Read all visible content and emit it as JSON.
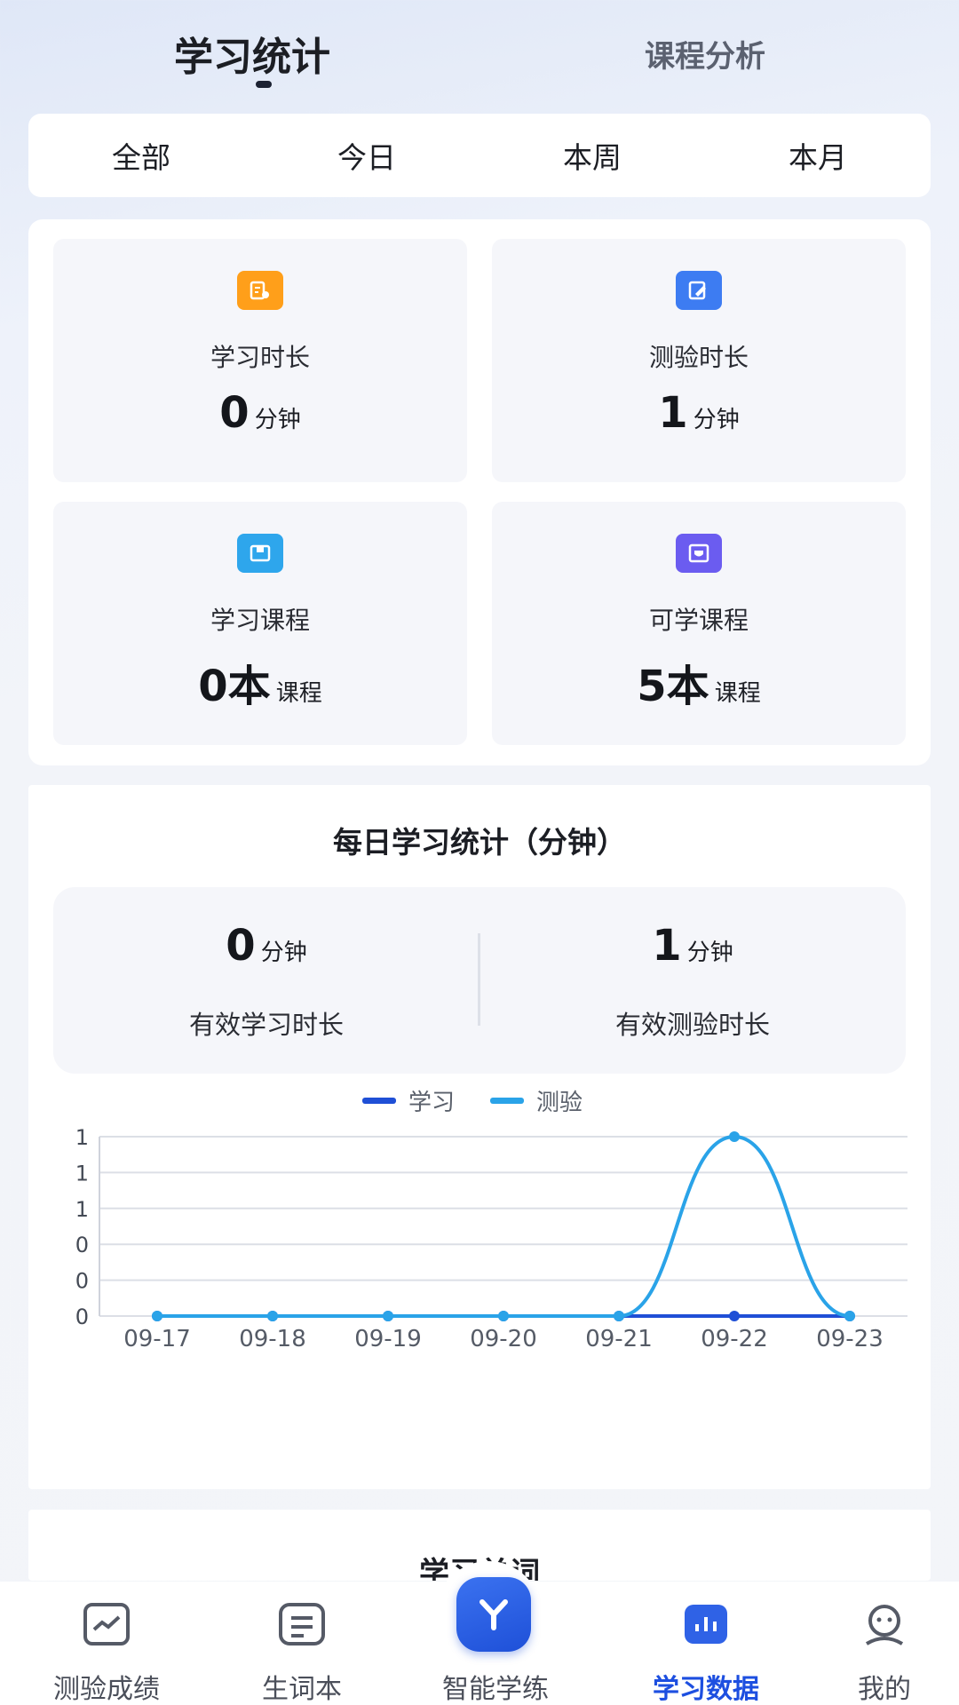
{
  "top_tabs": {
    "active": "学习统计",
    "inactive": "课程分析"
  },
  "filters": [
    "全部",
    "今日",
    "本周",
    "本月"
  ],
  "stats": [
    {
      "label": "学习时长",
      "value": "0",
      "unit": "分钟",
      "icon": "study-time-icon",
      "color": "#ff9f1a"
    },
    {
      "label": "测验时长",
      "value": "1",
      "unit": "分钟",
      "icon": "quiz-time-icon",
      "color": "#3d7cf2"
    },
    {
      "label": "学习课程",
      "value": "0本",
      "unit": "课程",
      "icon": "course-icon",
      "color": "#2ea6ec"
    },
    {
      "label": "可学课程",
      "value": "5本",
      "unit": "课程",
      "icon": "available-course-icon",
      "color": "#6b5cf0"
    }
  ],
  "daily": {
    "title": "每日学习统计（分钟）",
    "study": {
      "value": "0",
      "unit": "分钟",
      "caption": "有效学习时长"
    },
    "quiz": {
      "value": "1",
      "unit": "分钟",
      "caption": "有效测验时长"
    }
  },
  "chart_data": {
    "type": "line",
    "x": [
      "09-17",
      "09-18",
      "09-19",
      "09-20",
      "09-21",
      "09-22",
      "09-23"
    ],
    "series": [
      {
        "name": "学习",
        "color": "#1f4fd6",
        "values": [
          0,
          0,
          0,
          0,
          0,
          0,
          0
        ]
      },
      {
        "name": "测验",
        "color": "#2aa3e8",
        "values": [
          0,
          0,
          0,
          0,
          0,
          1,
          0
        ]
      }
    ],
    "y_tick_labels": [
      "0",
      "0",
      "0",
      "1",
      "1",
      "1"
    ],
    "ylim": [
      0,
      1
    ],
    "grid": true,
    "legend": "top-center",
    "smooth": true
  },
  "next_section": {
    "title": "学习单词"
  },
  "bottom_nav": [
    {
      "label": "测验成绩",
      "icon": "quiz-score-icon"
    },
    {
      "label": "生词本",
      "icon": "vocabulary-icon"
    },
    {
      "label": "智能学练",
      "icon": "smart-practice-icon"
    },
    {
      "label": "学习数据",
      "icon": "study-data-icon",
      "active": true
    },
    {
      "label": "我的",
      "icon": "profile-icon"
    }
  ]
}
